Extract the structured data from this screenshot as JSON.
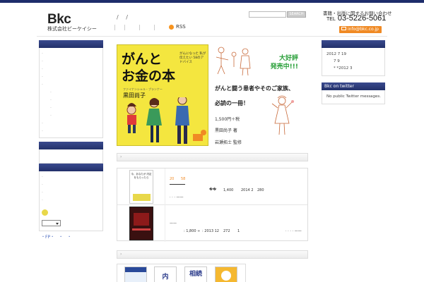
{
  "header": {
    "logo": "Bkc",
    "company": "株式会社ビーケイシー",
    "nav_slashes": "/ /",
    "rss_label": "RSS",
    "search_button": "SEARCH",
    "contact_label": "書籍・出版に関するお問い合わせ",
    "tel_prefix": "TEL",
    "tel": "03-5226-5061",
    "mail": "info@bkc.co.jp"
  },
  "feature": {
    "cover_title_line1": "がんと",
    "cover_title_line2": "お金の本",
    "cover_side": "がんになった 私が伝えたい 58のアドバイス",
    "cover_byline": "ファイナンシャル・プランナー",
    "cover_author": "黒田尚子",
    "hot_line1": "大好評",
    "hot_line2": "発売中!!!",
    "copy1": "がんと闘う患者やそのご家族、",
    "copy2": "必読の一冊！",
    "price": "1,500円＋税",
    "author": "黒田尚子 著",
    "supervisor": "岩瀬拓士 監修"
  },
  "sections": {
    "bar1": "›",
    "bar2": "›"
  },
  "books": {
    "row1": {
      "top_left": "20",
      "top_right": "58",
      "mark": "��",
      "price": "1,400",
      "date": "2014 2",
      "pages": "280",
      "dots": "· · · ——"
    },
    "row2": {
      "dash": "——",
      "price": ": 1,800 ÷",
      "date": ": 2013 12",
      "pages": "272",
      "count": "1",
      "dots": "· · · · ——"
    },
    "thumb1_text": "今、あなたが 内定 をもらったら",
    "thumb3_text": "相続"
  },
  "right_sidebar": {
    "archive_items": [
      "2012 7 19",
      "7 9",
      "* *2012 3"
    ],
    "twitter_head": "Bkc on twitter",
    "twitter_text": "No public Twitter messages."
  },
  "left_sidebar": {
    "fp_links": "・FP・　・　・"
  },
  "colors": {
    "navy": "#1e2d6b",
    "accent_orange": "#f08a24",
    "cover_yellow": "#f4e63f",
    "promo_green": "#2aa03a"
  }
}
